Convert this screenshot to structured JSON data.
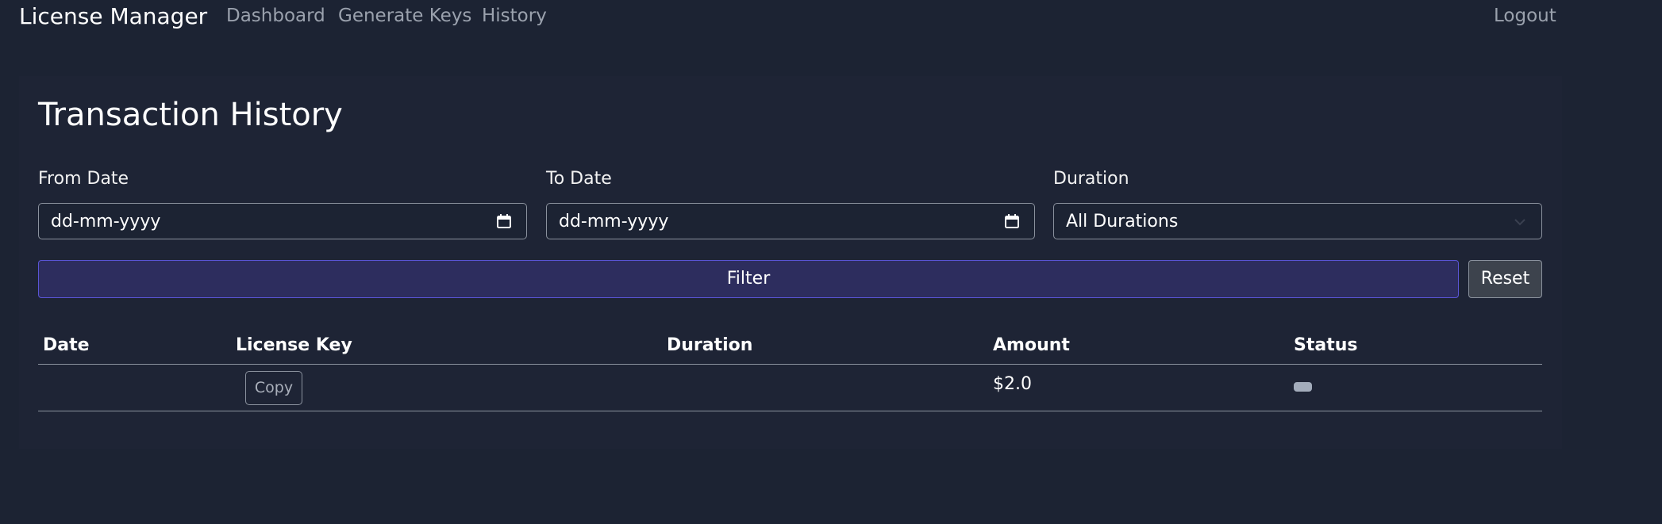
{
  "navbar": {
    "brand": "License Manager",
    "links": [
      "Dashboard",
      "Generate Keys",
      "History"
    ],
    "logout": "Logout"
  },
  "page": {
    "title": "Transaction History"
  },
  "filters": {
    "from_label": "From Date",
    "from_value": "dd-mm-yyyy",
    "to_label": "To Date",
    "to_value": "dd-mm-yyyy",
    "duration_label": "Duration",
    "duration_value": "All Durations",
    "filter_button": "Filter",
    "reset_button": "Reset"
  },
  "table": {
    "headers": [
      "Date",
      "License Key",
      "Duration",
      "Amount",
      "Status"
    ],
    "rows": [
      {
        "date": "",
        "copy_button": "Copy",
        "duration": "",
        "amount": "$2.0",
        "status_color": "#a3acbb"
      }
    ]
  },
  "colors": {
    "background": "#1c2333",
    "primary_button": "#2d2d5e",
    "primary_border": "#5a55d6",
    "secondary_button": "#3d434d"
  }
}
